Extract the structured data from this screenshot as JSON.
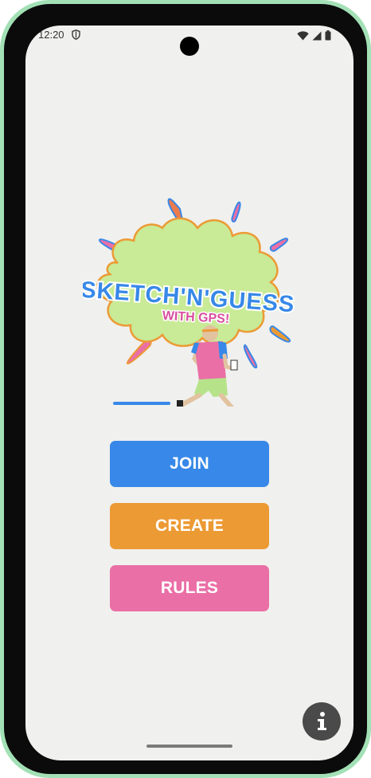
{
  "status_bar": {
    "time": "12:20",
    "icons": [
      "shield-icon",
      "wifi-icon",
      "signal-icon",
      "battery-icon"
    ]
  },
  "logo": {
    "title": "SKETCH'N'GUESS",
    "subtitle": "WITH GPS!"
  },
  "buttons": {
    "join_label": "JOIN",
    "create_label": "CREATE",
    "rules_label": "RULES"
  },
  "info": {
    "icon": "info-icon",
    "glyph": "i"
  },
  "colors": {
    "join": "#3788e8",
    "create": "#ec9a34",
    "rules": "#ea6fa6",
    "background": "#f0f0ee",
    "frame": "#a3e0b6"
  }
}
